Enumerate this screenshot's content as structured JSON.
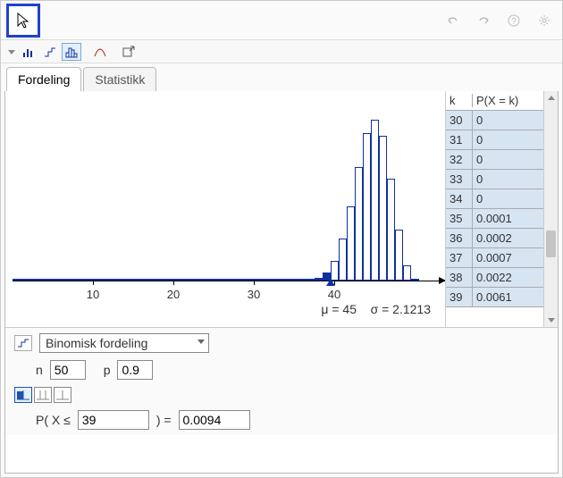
{
  "toolbar": {
    "cursor_tool": "cursor-arrow"
  },
  "tabs": {
    "fordeling": "Fordeling",
    "statistikk": "Statistikk"
  },
  "chart_data": {
    "type": "bar",
    "title": "",
    "xlabel": "",
    "ylabel": "",
    "x_ticks": [
      10,
      20,
      30,
      40
    ],
    "categories": [
      30,
      31,
      32,
      33,
      34,
      35,
      36,
      37,
      38,
      39,
      40,
      41,
      42,
      43,
      44,
      45,
      46,
      47,
      48,
      49,
      50
    ],
    "values": [
      0,
      0,
      0,
      0,
      0,
      0.0001,
      0.0002,
      0.0007,
      0.0022,
      0.0061,
      0.0152,
      0.0319,
      0.0571,
      0.087,
      0.1128,
      0.1231,
      0.1108,
      0.0779,
      0.0389,
      0.0113,
      0.0015
    ],
    "shaded_upto_index": 9,
    "mu": 45,
    "sigma": 2.1213,
    "xlim": [
      0,
      52
    ]
  },
  "stats_line": {
    "mu_label": "μ = ",
    "mu_value": "45",
    "sigma_label": "σ = ",
    "sigma_value": "2.1213"
  },
  "table": {
    "header_k": "k",
    "header_p": "P(X = k)",
    "rows": [
      {
        "k": "30",
        "p": "0"
      },
      {
        "k": "31",
        "p": "0"
      },
      {
        "k": "32",
        "p": "0"
      },
      {
        "k": "33",
        "p": "0"
      },
      {
        "k": "34",
        "p": "0"
      },
      {
        "k": "35",
        "p": "0.0001"
      },
      {
        "k": "36",
        "p": "0.0002"
      },
      {
        "k": "37",
        "p": "0.0007"
      },
      {
        "k": "38",
        "p": "0.0022"
      },
      {
        "k": "39",
        "p": "0.0061"
      }
    ]
  },
  "controls": {
    "distribution_name": "Binomisk fordeling",
    "n_label": "n",
    "n_value": "50",
    "p_label": "p",
    "p_value": "0.9",
    "calc_prefix": "P( X ≤",
    "calc_x": "39",
    "calc_mid": ") =",
    "calc_result": "0.0094"
  }
}
